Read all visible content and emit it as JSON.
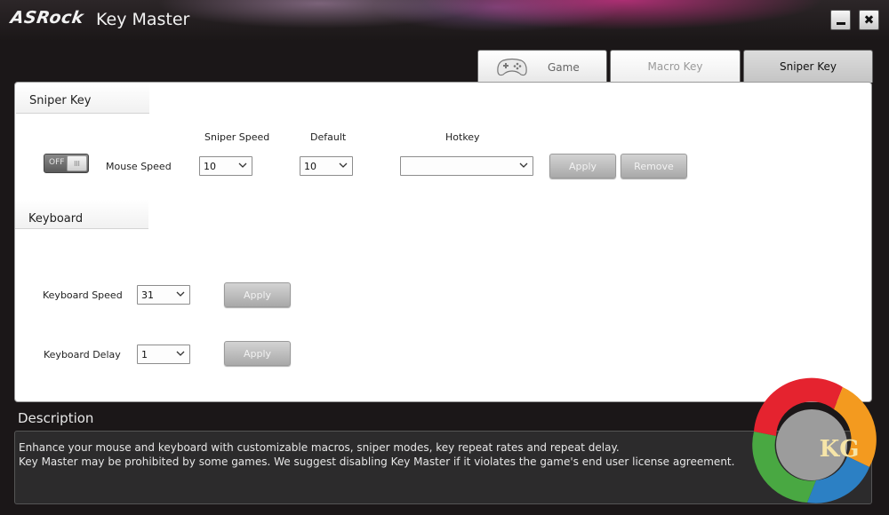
{
  "window": {
    "brand": "ASRock",
    "title": "Key Master",
    "minimize_icon": "minimize-icon",
    "close_icon": "close-icon"
  },
  "tabs": [
    {
      "label": "Game",
      "icon": "gamepad-icon",
      "state": "default"
    },
    {
      "label": "Macro Key",
      "state": "disabled"
    },
    {
      "label": "Sniper Key",
      "state": "selected"
    }
  ],
  "sniper": {
    "section_title": "Sniper Key",
    "toggle_text": "OFF",
    "toggle_knob": "lll",
    "mouse_speed_label": "Mouse Speed",
    "col_sniper_speed": "Sniper Speed",
    "col_default": "Default",
    "col_hotkey": "Hotkey",
    "sniper_speed_value": "10",
    "default_value": "10",
    "hotkey_value": "",
    "apply_label": "Apply",
    "remove_label": "Remove"
  },
  "keyboard": {
    "section_title": "Keyboard",
    "speed_label": "Keyboard Speed",
    "speed_value": "31",
    "delay_label": "Keyboard Delay",
    "delay_value": "1",
    "apply_label": "Apply"
  },
  "description": {
    "title": "Description",
    "line1": "Enhance your mouse and keyboard with customizable macros, sniper modes, key repeat rates and repeat delay.",
    "line2": "Key Master may be prohibited by some games. We suggest disabling Key Master if it violates the game's end user license agreement."
  },
  "watermark": {
    "text": "KG",
    "colors": [
      "#e5232f",
      "#f39a1f",
      "#49a842",
      "#2c80c4"
    ]
  }
}
